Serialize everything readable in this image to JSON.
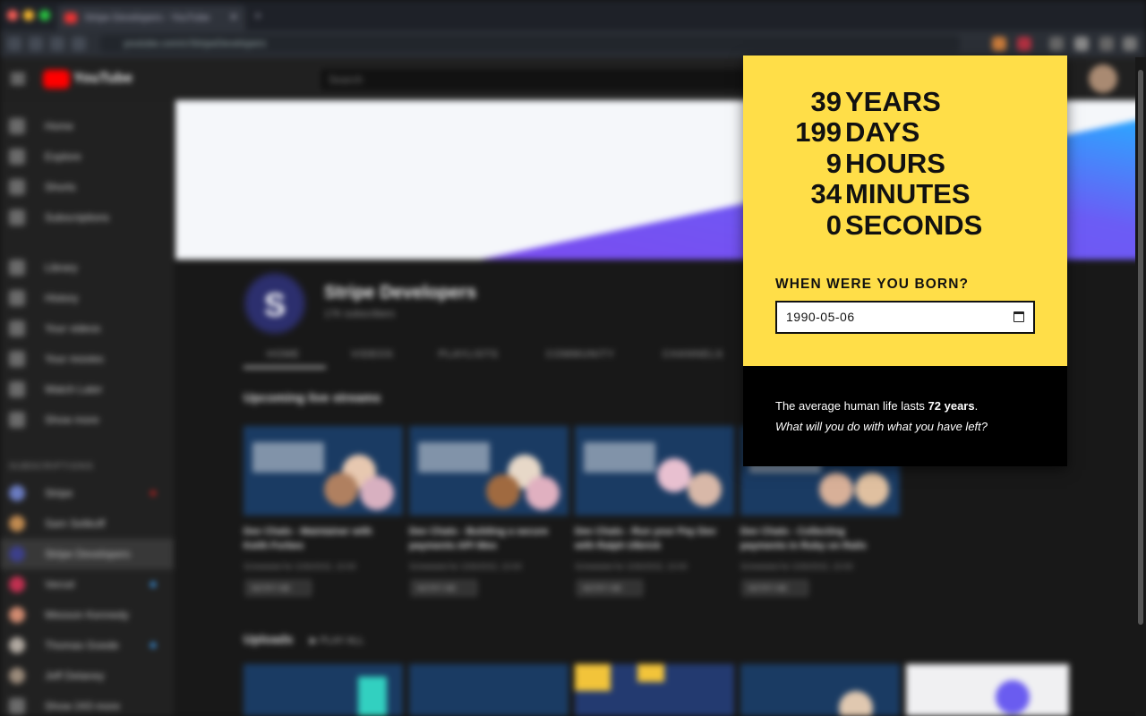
{
  "browser": {
    "tab_title": "Stripe Developers - YouTube",
    "url": "youtube.com/c/StripeDevelopers"
  },
  "youtube": {
    "logo_text": "YouTube",
    "search_placeholder": "Search",
    "sidebar": {
      "items": [
        {
          "label": "Home"
        },
        {
          "label": "Explore"
        },
        {
          "label": "Shorts"
        },
        {
          "label": "Subscriptions"
        },
        {
          "label": "Library"
        },
        {
          "label": "History"
        },
        {
          "label": "Your videos"
        },
        {
          "label": "Your movies"
        },
        {
          "label": "Watch Later"
        },
        {
          "label": "Show more"
        }
      ],
      "subscriptions_heading": "SUBSCRIPTIONS",
      "subscriptions": [
        {
          "label": "Stripe"
        },
        {
          "label": "Sam Selikoff"
        },
        {
          "label": "Stripe Developers"
        },
        {
          "label": "Vercel"
        },
        {
          "label": "Wesson Kennedy"
        },
        {
          "label": "Thomas Goede"
        },
        {
          "label": "Jeff Delaney"
        },
        {
          "label": "Show 243 more"
        }
      ]
    },
    "channel": {
      "initial": "S",
      "name": "Stripe Developers",
      "subscribers": "17K subscribers"
    },
    "tabs": [
      "HOME",
      "VIDEOS",
      "PLAYLISTS",
      "COMMUNITY",
      "CHANNELS"
    ],
    "section_title": "Upcoming live streams",
    "videos": [
      {
        "title": "Dev Chats - Maintainer with Keith Forbes",
        "meta": "Scheduled for 2/26/2022, 10:00",
        "badge": "NOTIFY ME"
      },
      {
        "title": "Dev Chats - Building a secure payments API Wes",
        "meta": "Scheduled for 2/26/2022, 10:00",
        "badge": "NOTIFY ME"
      },
      {
        "title": "Dev Chats - Run your Pay Dev with Ralph Ulbrick",
        "meta": "Scheduled for 2/26/2022, 10:00",
        "badge": "NOTIFY ME"
      },
      {
        "title": "Dev Chats - Collecting payments in Ruby on Rails",
        "meta": "Scheduled for 2/26/2022, 10:00",
        "badge": "NOTIFY ME"
      }
    ],
    "uploads_title": "Uploads",
    "play_all": "PLAY ALL"
  },
  "popup": {
    "countdown": [
      {
        "value": "39",
        "unit": "YEARS"
      },
      {
        "value": "199",
        "unit": "DAYS"
      },
      {
        "value": "9",
        "unit": "HOURS"
      },
      {
        "value": "34",
        "unit": "MINUTES"
      },
      {
        "value": "0",
        "unit": "SECONDS"
      }
    ],
    "born_label": "WHEN WERE YOU BORN?",
    "birth_date": "1990-05-06",
    "avg_prefix": "The average human life lasts ",
    "avg_value": "72 years",
    "avg_suffix": ".",
    "question": "What will you do with what you have left?"
  },
  "colors": {
    "popup_yellow": "#ffde48",
    "popup_black": "#000000",
    "youtube_bg": "#181818",
    "youtube_red": "#ff0000"
  }
}
